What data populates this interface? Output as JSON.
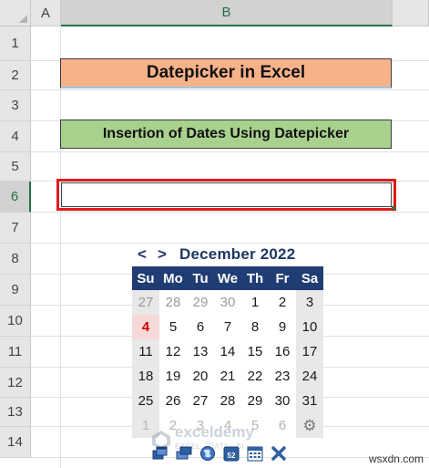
{
  "sheet": {
    "columns": [
      "A",
      "B"
    ],
    "rows": [
      "1",
      "2",
      "3",
      "4",
      "5",
      "6",
      "7",
      "8",
      "9",
      "10",
      "11",
      "12",
      "13",
      "14"
    ],
    "selected_column": "B",
    "selected_row": "6"
  },
  "cells": {
    "title": "Datepicker in Excel",
    "subtitle": "Insertion of Dates Using Datepicker",
    "date_input_value": ""
  },
  "datepicker": {
    "prev_label": "<",
    "next_label": ">",
    "month_label": "December 2022",
    "weekdays": [
      "Su",
      "Mo",
      "Tu",
      "We",
      "Th",
      "Fr",
      "Sa"
    ],
    "weeks": [
      [
        "27",
        "28",
        "29",
        "30",
        "1",
        "2",
        "3"
      ],
      [
        "4",
        "5",
        "6",
        "7",
        "8",
        "9",
        "10"
      ],
      [
        "11",
        "12",
        "13",
        "14",
        "15",
        "16",
        "17"
      ],
      [
        "18",
        "19",
        "20",
        "21",
        "22",
        "23",
        "24"
      ],
      [
        "25",
        "26",
        "27",
        "28",
        "29",
        "30",
        "31"
      ],
      [
        "1",
        "2",
        "3",
        "4",
        "5",
        "6",
        "⚙"
      ]
    ],
    "today": "4",
    "colors": {
      "header_bg": "#1f3d73",
      "today": "#d50000",
      "weekend_bg": "#e8e8e8"
    },
    "toolbar": [
      {
        "icon": "window-restore-icon"
      },
      {
        "icon": "window-minimize-icon"
      },
      {
        "icon": "globe-icon"
      },
      {
        "icon": "week-number-icon",
        "label": "52"
      },
      {
        "icon": "calendar-icon"
      },
      {
        "icon": "close-icon"
      }
    ]
  },
  "watermark": {
    "name": "exceldemy",
    "tagline": "EXCEL · DATA · BI"
  },
  "site_badge": "wsxdn.com"
}
